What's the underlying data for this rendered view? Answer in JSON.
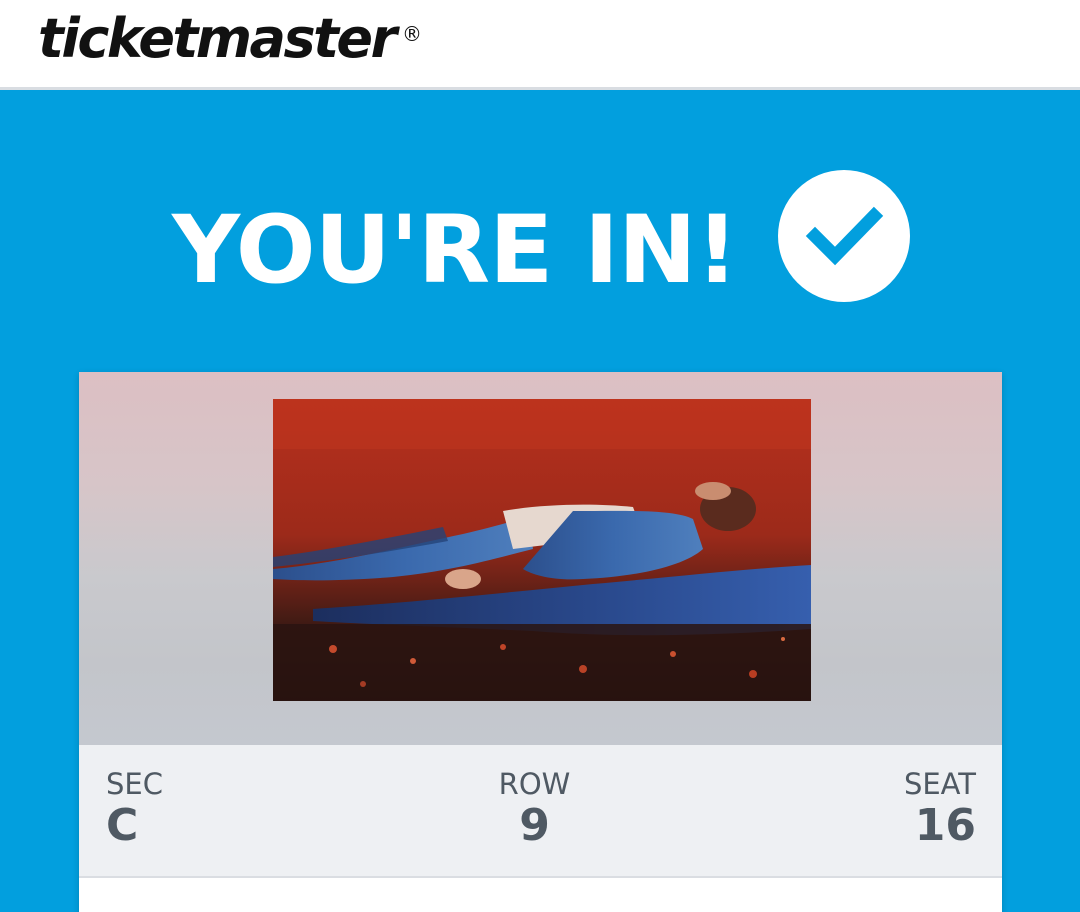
{
  "header": {
    "brand": "ticketmaster",
    "registered_mark": "®"
  },
  "hero": {
    "title": "YOU'RE IN!",
    "status_icon": "check-circle-icon"
  },
  "ticket": {
    "sec_label": "SEC",
    "sec_value": "C",
    "row_label": "ROW",
    "row_value": "9",
    "seat_label": "SEAT",
    "seat_value": "16"
  },
  "colors": {
    "brand_blue": "#029fde",
    "header_bg": "#ffffff",
    "seat_panel_bg": "#eef0f3",
    "seat_text": "#4f5963"
  }
}
